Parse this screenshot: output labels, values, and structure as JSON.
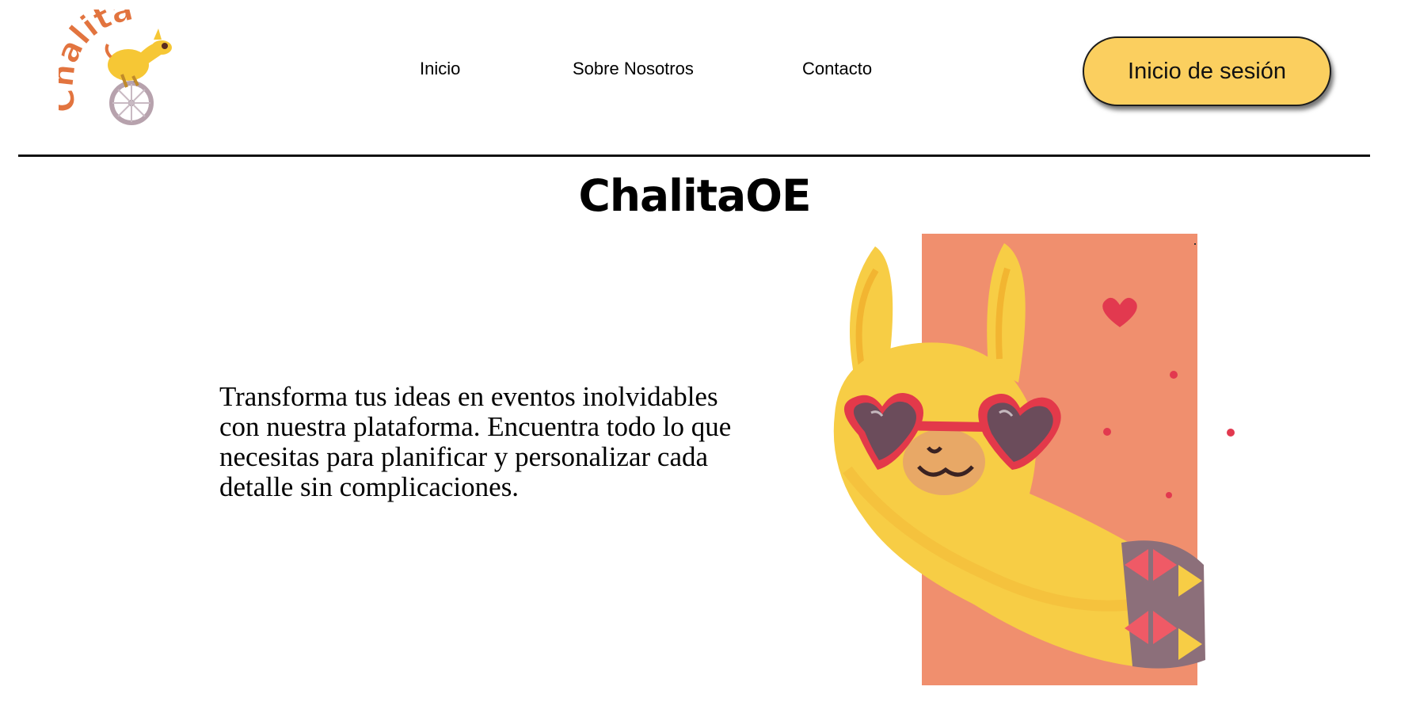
{
  "header": {
    "logo_text": "Chalita",
    "logo_alt": "Chalita",
    "nav": [
      {
        "label": "Inicio"
      },
      {
        "label": "Sobre Nosotros"
      },
      {
        "label": "Contacto"
      }
    ],
    "login_label": "Inicio de sesión"
  },
  "main": {
    "title": "ChalitaOE",
    "description": "Transforma tus ideas en eventos inolvidables con nuestra plataforma. Encuentra todo lo que necesitas para planificar y personalizar cada detalle sin complicaciones."
  },
  "colors": {
    "login_button": "#fbcf5f",
    "logo_orange": "#e2743f",
    "llama_yellow": "#f7cd45",
    "image_panel": "#f08f6e",
    "glasses_red": "#e3394a"
  }
}
